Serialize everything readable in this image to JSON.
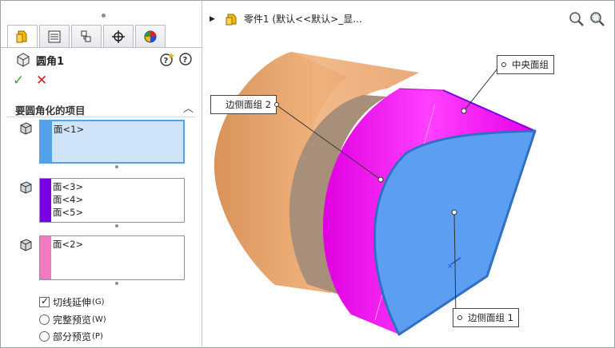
{
  "feature": {
    "title": "圆角1"
  },
  "section": {
    "title": "要圆角化的项目"
  },
  "selections": [
    {
      "items": [
        "面<1>"
      ]
    },
    {
      "items": [
        "面<3>",
        "面<4>",
        "面<5>"
      ]
    },
    {
      "items": [
        "面<2>"
      ]
    }
  ],
  "options": {
    "tangent": {
      "label": "切线延伸",
      "key": "(G)"
    },
    "full_preview": {
      "label": "完整预览",
      "key": "(W)"
    },
    "partial_preview": {
      "label": "部分预览",
      "key": "(P)"
    }
  },
  "breadcrumb": {
    "text": "零件1  (默认<<默认>_显..."
  },
  "callouts": {
    "center": "中央面组",
    "side2": "边侧面组 2",
    "side1": "边侧面组 1"
  },
  "colors": {
    "face_blue": "#5b9ef2",
    "face_magenta": "#f200f2",
    "swatch_blue": "#55a1e8",
    "swatch_purple": "#7a00e6",
    "swatch_pink": "#f07ac0",
    "body_tan": "#e8a06a"
  },
  "icons": {
    "ok": "✓",
    "cancel": "✕",
    "help": "?",
    "collapse": "︿"
  }
}
